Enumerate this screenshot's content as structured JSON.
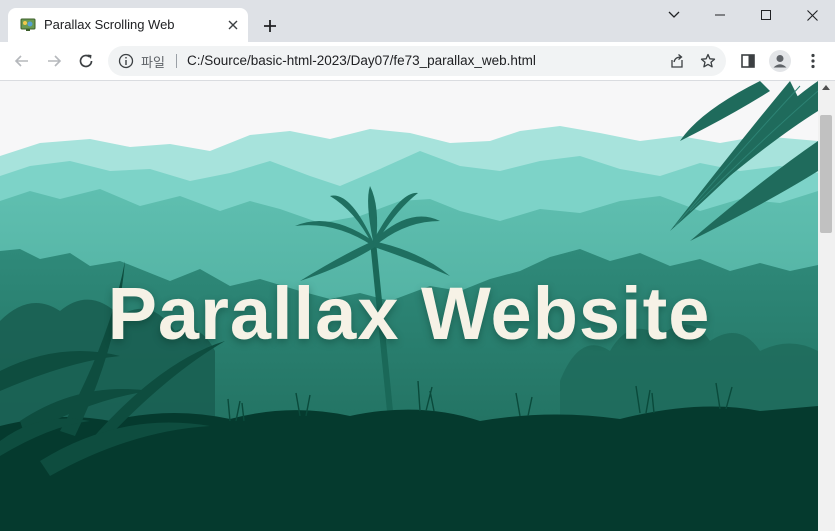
{
  "browser": {
    "tab": {
      "title": "Parallax Scrolling Web"
    },
    "new_tab_icon": "plus-icon",
    "window_controls": [
      "chevron-down-icon",
      "minimize-icon",
      "maximize-icon",
      "close-icon"
    ],
    "toolbar": {
      "scheme_label": "파일",
      "url": "C:/Source/basic-html-2023/Day07/fe73_parallax_web.html",
      "icons": [
        "back-icon",
        "forward-icon",
        "reload-icon",
        "info-icon",
        "share-icon",
        "star-icon",
        "side-panel-icon",
        "profile-icon",
        "more-icon"
      ]
    }
  },
  "page": {
    "hero_title": "Parallax Website",
    "colors": {
      "sky": "#f7f7f8",
      "far_hills": "#a7e3dc",
      "mid_hills": "#7dd3c8",
      "near_hills": "#4eb3a5",
      "forest": "#2f8a7a",
      "ground": "#053a2e",
      "title_text": "#f6f2e6"
    }
  }
}
